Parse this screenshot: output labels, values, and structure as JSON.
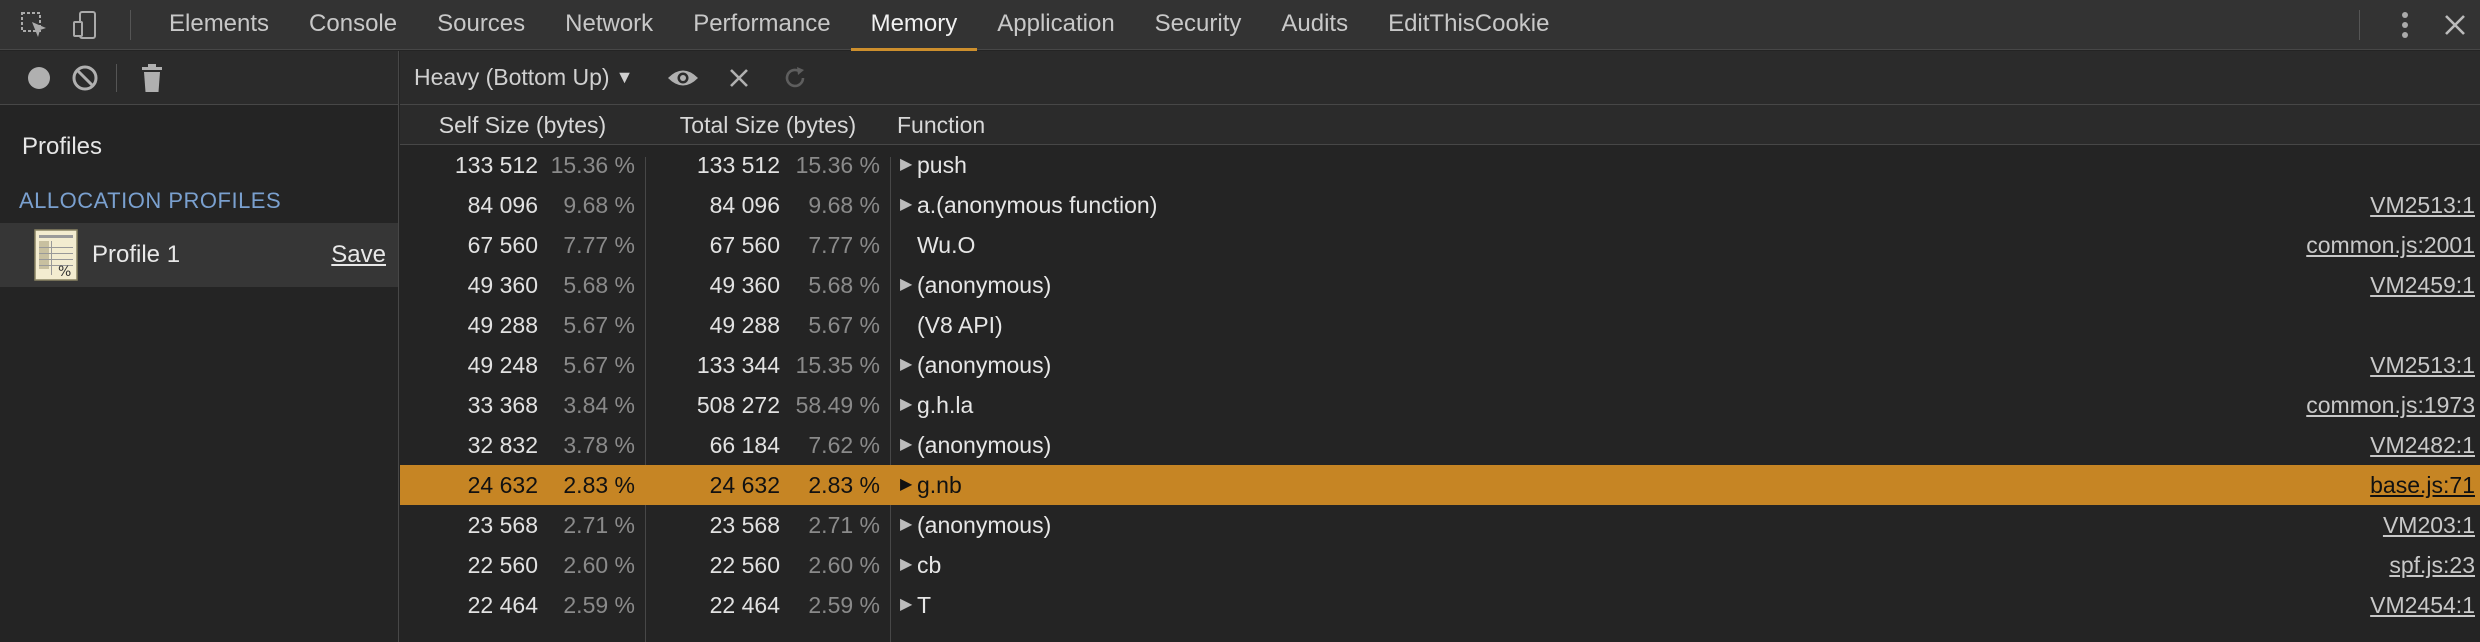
{
  "tabs": [
    {
      "label": "Elements",
      "active": false
    },
    {
      "label": "Console",
      "active": false
    },
    {
      "label": "Sources",
      "active": false
    },
    {
      "label": "Network",
      "active": false
    },
    {
      "label": "Performance",
      "active": false
    },
    {
      "label": "Memory",
      "active": true
    },
    {
      "label": "Application",
      "active": false
    },
    {
      "label": "Security",
      "active": false
    },
    {
      "label": "Audits",
      "active": false
    },
    {
      "label": "EditThisCookie",
      "active": false
    }
  ],
  "sidebar": {
    "profiles_title": "Profiles",
    "section_title": "ALLOCATION PROFILES",
    "profile": {
      "name": "Profile 1",
      "save_label": "Save"
    }
  },
  "toolbar": {
    "view_selector": "Heavy (Bottom Up)"
  },
  "columns": {
    "self": "Self Size (bytes)",
    "total": "Total Size (bytes)",
    "function": "Function"
  },
  "rows": [
    {
      "self": "133 512",
      "self_pct": "15.36 %",
      "total": "133 512",
      "total_pct": "15.36 %",
      "expandable": true,
      "function": "push",
      "url": "",
      "selected": false
    },
    {
      "self": "84 096",
      "self_pct": "9.68 %",
      "total": "84 096",
      "total_pct": "9.68 %",
      "expandable": true,
      "function": "a.(anonymous function)",
      "url": "VM2513:1",
      "selected": false
    },
    {
      "self": "67 560",
      "self_pct": "7.77 %",
      "total": "67 560",
      "total_pct": "7.77 %",
      "expandable": false,
      "function": "Wu.O",
      "url": "common.js:2001",
      "selected": false
    },
    {
      "self": "49 360",
      "self_pct": "5.68 %",
      "total": "49 360",
      "total_pct": "5.68 %",
      "expandable": true,
      "function": "(anonymous)",
      "url": "VM2459:1",
      "selected": false
    },
    {
      "self": "49 288",
      "self_pct": "5.67 %",
      "total": "49 288",
      "total_pct": "5.67 %",
      "expandable": false,
      "function": "(V8 API)",
      "url": "",
      "selected": false
    },
    {
      "self": "49 248",
      "self_pct": "5.67 %",
      "total": "133 344",
      "total_pct": "15.35 %",
      "expandable": true,
      "function": "(anonymous)",
      "url": "VM2513:1",
      "selected": false
    },
    {
      "self": "33 368",
      "self_pct": "3.84 %",
      "total": "508 272",
      "total_pct": "58.49 %",
      "expandable": true,
      "function": "g.h.la",
      "url": "common.js:1973",
      "selected": false
    },
    {
      "self": "32 832",
      "self_pct": "3.78 %",
      "total": "66 184",
      "total_pct": "7.62 %",
      "expandable": true,
      "function": "(anonymous)",
      "url": "VM2482:1",
      "selected": false
    },
    {
      "self": "24 632",
      "self_pct": "2.83 %",
      "total": "24 632",
      "total_pct": "2.83 %",
      "expandable": true,
      "function": "g.nb",
      "url": "base.js:71",
      "selected": true
    },
    {
      "self": "23 568",
      "self_pct": "2.71 %",
      "total": "23 568",
      "total_pct": "2.71 %",
      "expandable": true,
      "function": "(anonymous)",
      "url": "VM203:1",
      "selected": false
    },
    {
      "self": "22 560",
      "self_pct": "2.60 %",
      "total": "22 560",
      "total_pct": "2.60 %",
      "expandable": true,
      "function": "cb",
      "url": "spf.js:23",
      "selected": false
    },
    {
      "self": "22 464",
      "self_pct": "2.59 %",
      "total": "22 464",
      "total_pct": "2.59 %",
      "expandable": true,
      "function": "T",
      "url": "VM2454:1",
      "selected": false
    }
  ],
  "colors": {
    "accent": "#cd8f2d",
    "selected_row": "#c68524",
    "section_title": "#7aa0cf"
  }
}
